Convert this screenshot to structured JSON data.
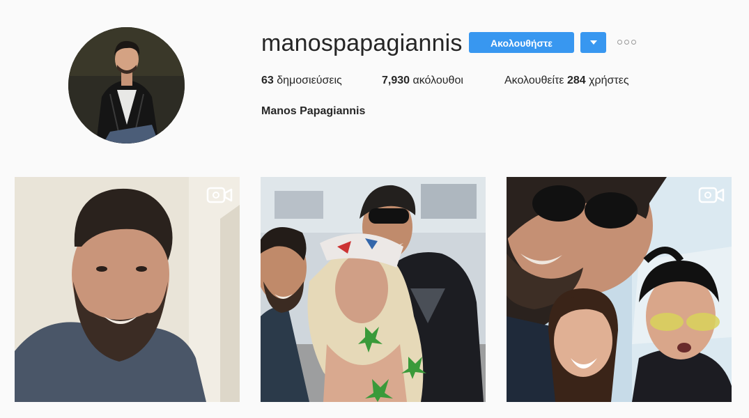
{
  "profile": {
    "username": "manospapagiannis",
    "full_name": "Manos Papagiannis",
    "follow_label": "Ακολουθήστε"
  },
  "stats": {
    "posts_count": "63",
    "posts_label": "δημοσιεύσεις",
    "followers_count": "7,930",
    "followers_label": "ακόλουθοι",
    "following_prefix": "Ακολουθείτε",
    "following_count": "284",
    "following_suffix": "χρήστες"
  },
  "posts": [
    {
      "media": "video",
      "icon": "video-camera-icon"
    },
    {
      "media": "photo"
    },
    {
      "media": "video",
      "icon": "video-camera-icon"
    }
  ],
  "colors": {
    "accent": "#3897f0",
    "background": "#fafafa",
    "text": "#262626"
  }
}
